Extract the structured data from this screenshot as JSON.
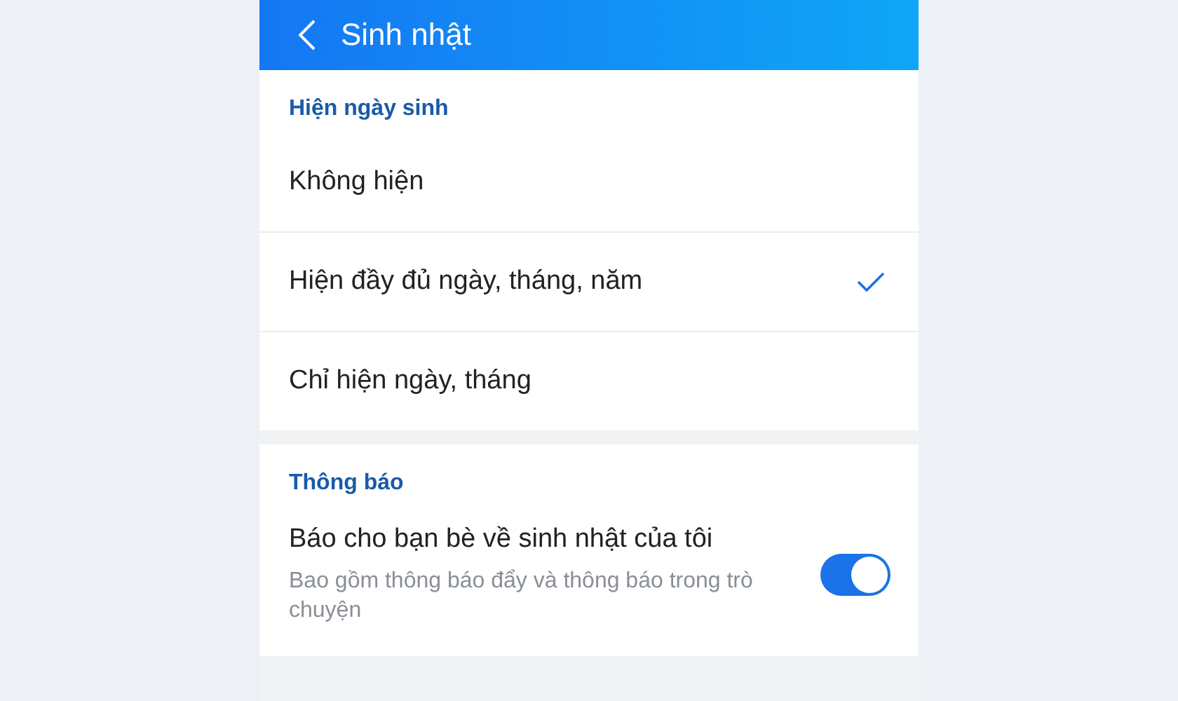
{
  "header": {
    "title": "Sinh nhật"
  },
  "sections": [
    {
      "title": "Hiện ngày sinh",
      "items": [
        {
          "kind": "option",
          "label": "Không hiện",
          "selected": false
        },
        {
          "kind": "option",
          "label": "Hiện đầy đủ ngày, tháng, năm",
          "selected": true
        },
        {
          "kind": "option",
          "label": "Chỉ hiện ngày, tháng",
          "selected": false
        }
      ]
    },
    {
      "title": "Thông báo",
      "items": [
        {
          "kind": "toggle",
          "label": "Báo cho bạn bè về sinh nhật của tôi",
          "description": "Bao gồm thông báo đẩy và thông báo trong trò chuyện",
          "on": true
        }
      ]
    }
  ]
}
